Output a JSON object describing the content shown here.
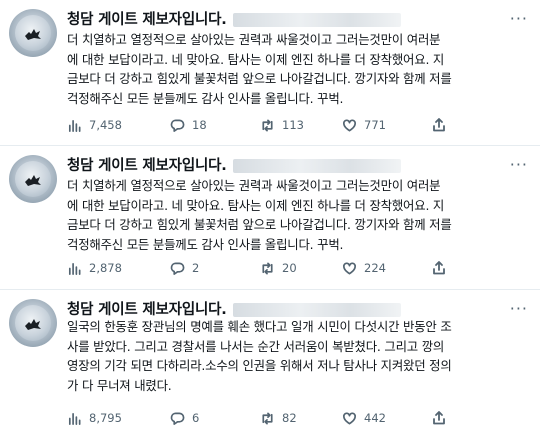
{
  "tweets": [
    {
      "name": "청담 게이트 제보자입니다.",
      "more": "···",
      "text": "더 치열하고 열정적으로 살아있는 권력과 싸울것이고 그러는것만이 여러분\n에 대한 보답이라고. 네 맞아요. 탐사는 이제 엔진 하나를 더 장착했어요. 지\n금보다 더 강하고 힘있게 불꽃처럼 앞으로 나아갈겁니다. 깡기자와 함께 저를\n걱정해주신 모든 분들께도 감사 인사를 올립니다. 꾸벅.",
      "views": "7,458",
      "replies": "18",
      "retweets": "113",
      "likes": "771"
    },
    {
      "name": "청담 게이트 제보자입니다.",
      "more": "···",
      "text": "더 치열하게 열정적으로 살아있는 권력과 싸울것이고 그러는것만이 여러분\n에 대한 보답이라고. 네 맞아요. 탐사는 이제 엔진 하나를 더 장착했어요. 지\n금보다 더 강하고 힘있게 불꽃처럼 앞으로 나아갈겁니다. 깡기자와 함께 저를\n걱정해주신 모든 분들께도 감사 인사를 올립니다. 꾸벅.",
      "views": "2,878",
      "replies": "2",
      "retweets": "20",
      "likes": "224"
    },
    {
      "name": "청담 게이트 제보자입니다.",
      "more": "···",
      "text": "일국의 한동훈 장관님의 명예를 훼손 했다고 일개 시민이 다섯시간 반동안 조\n사를 받았다. 그리고 경찰서를 나서는 순간 서러움이 복받쳤다. 그리고 깡의\n영장의 기각 되면 다하리라.소수의 인권을 위해서 저나 탐사나 지켜왔던 정의\n가 다 무너져 내렸다.",
      "views": "8,795",
      "replies": "6",
      "retweets": "82",
      "likes": "442"
    }
  ],
  "icons": {
    "views": "bar-chart-icon",
    "reply": "reply-bubble-icon",
    "retweet": "retweet-icon",
    "like": "heart-icon",
    "share": "share-icon"
  },
  "colors": {
    "text": "#0f1419",
    "secondary": "#536471",
    "divider": "#e6ecf0"
  }
}
